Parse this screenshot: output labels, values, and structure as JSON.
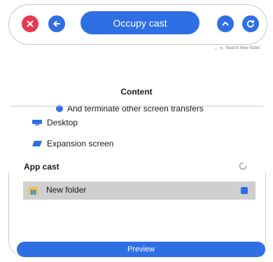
{
  "toolbar": {
    "title": "Occupy cast",
    "icons": [
      "close-icon",
      "back-arrow-icon",
      "chevron-up-icon",
      "refresh-icon"
    ]
  },
  "explorer_strip": {
    "search_text": "Search New folder"
  },
  "content": {
    "heading": "Content",
    "terminate_label": "And terminate other screen transfers"
  },
  "screens": [
    {
      "label": "Desktop",
      "icon": "monitor-icon"
    },
    {
      "label": "Expansion screen",
      "icon": "extended-display-icon"
    }
  ],
  "app_cast": {
    "heading": "App cast",
    "items": [
      {
        "label": "New folder",
        "icon": "folder-icon",
        "selected": true
      }
    ]
  },
  "preview": {
    "label": "Preview"
  },
  "colors": {
    "accent": "#2f6fe4",
    "close": "#e8384f",
    "selected_row": "#cfcfcf"
  }
}
